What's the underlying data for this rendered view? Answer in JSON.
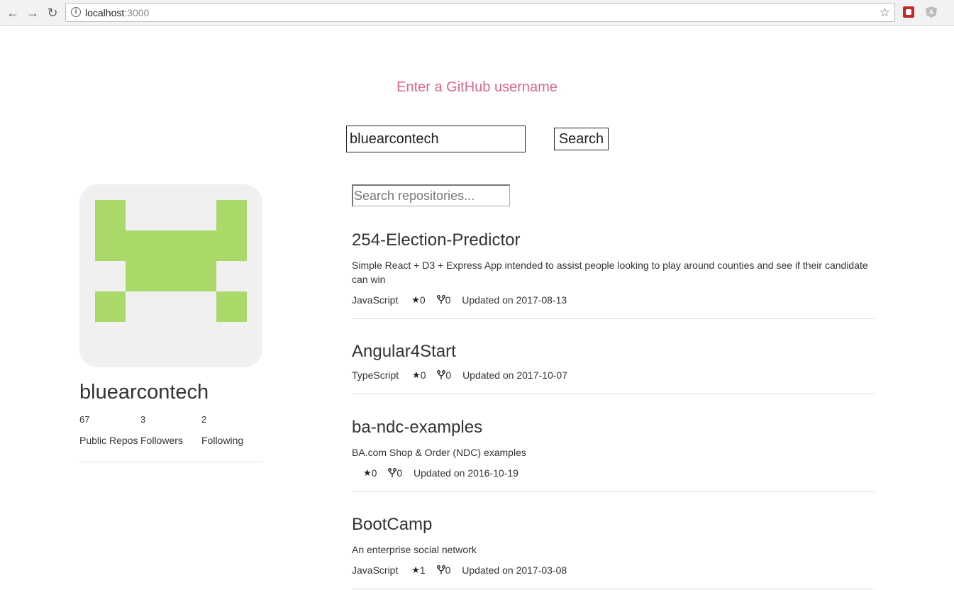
{
  "browser": {
    "url_host": "localhost",
    "url_port": ":3000"
  },
  "page": {
    "headline": "Enter a GitHub username",
    "username_value": "bluearcontech",
    "search_label": "Search",
    "repo_search_placeholder": "Search repositories..."
  },
  "avatar_color": "#aad96a",
  "profile": {
    "name": "bluearcontech",
    "stats": [
      {
        "count": "67",
        "label": "Public Repos"
      },
      {
        "count": "3",
        "label": "Followers"
      },
      {
        "count": "2",
        "label": "Following"
      }
    ]
  },
  "repos": [
    {
      "name": "254-Election-Predictor",
      "description": "Simple React + D3 + Express App intended to assist people looking to play around counties and see if their candidate can win",
      "language": "JavaScript",
      "stars": "0",
      "forks": "0",
      "updated": "Updated on 2017-08-13"
    },
    {
      "name": "Angular4Start",
      "description": "",
      "language": "TypeScript",
      "stars": "0",
      "forks": "0",
      "updated": "Updated on 2017-10-07"
    },
    {
      "name": "ba-ndc-examples",
      "description": "BA.com Shop & Order (NDC) examples",
      "language": "",
      "stars": "0",
      "forks": "0",
      "updated": "Updated on 2016-10-19"
    },
    {
      "name": "BootCamp",
      "description": "An enterprise social network",
      "language": "JavaScript",
      "stars": "1",
      "forks": "0",
      "updated": "Updated on 2017-03-08"
    }
  ]
}
